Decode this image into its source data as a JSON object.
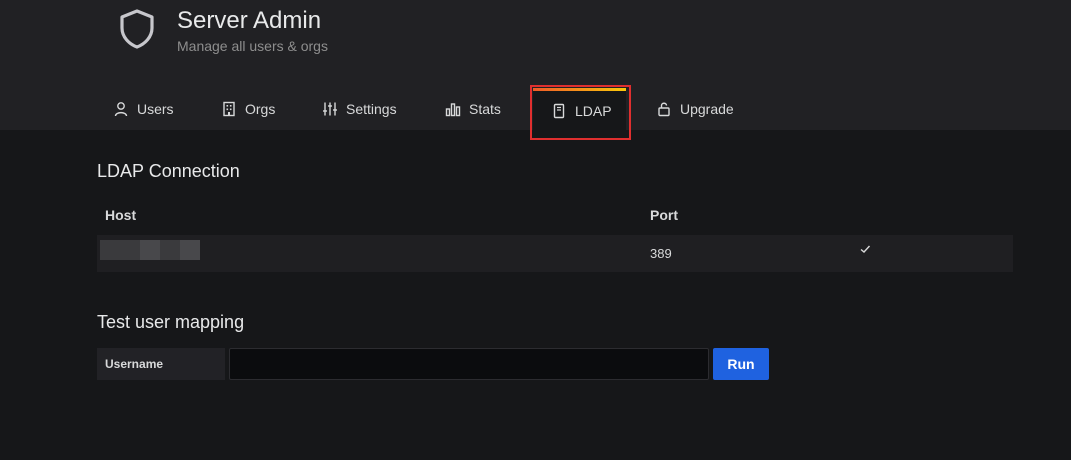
{
  "header": {
    "title": "Server Admin",
    "subtitle": "Manage all users & orgs",
    "icon": "shield-icon"
  },
  "tabs": [
    {
      "label": "Users",
      "icon": "user-icon",
      "active": false
    },
    {
      "label": "Orgs",
      "icon": "building-icon",
      "active": false
    },
    {
      "label": "Settings",
      "icon": "sliders-icon",
      "active": false
    },
    {
      "label": "Stats",
      "icon": "bar-chart-icon",
      "active": false
    },
    {
      "label": "LDAP",
      "icon": "book-icon",
      "active": true
    },
    {
      "label": "Upgrade",
      "icon": "lock-icon",
      "active": false
    }
  ],
  "ldap_connection": {
    "title": "LDAP Connection",
    "columns": {
      "host": "Host",
      "port": "Port"
    },
    "rows": [
      {
        "host": "",
        "port": "389",
        "status_icon": "check-icon"
      }
    ]
  },
  "test_mapping": {
    "title": "Test user mapping",
    "username_label": "Username",
    "username_value": "",
    "run_label": "Run"
  },
  "colors": {
    "background": "#161719",
    "header_bg": "#212124",
    "accent_blue": "#1f62e0",
    "highlight_red": "#e02f2f",
    "tab_gradient_start": "#f05a28",
    "tab_gradient_end": "#fbca0a"
  }
}
